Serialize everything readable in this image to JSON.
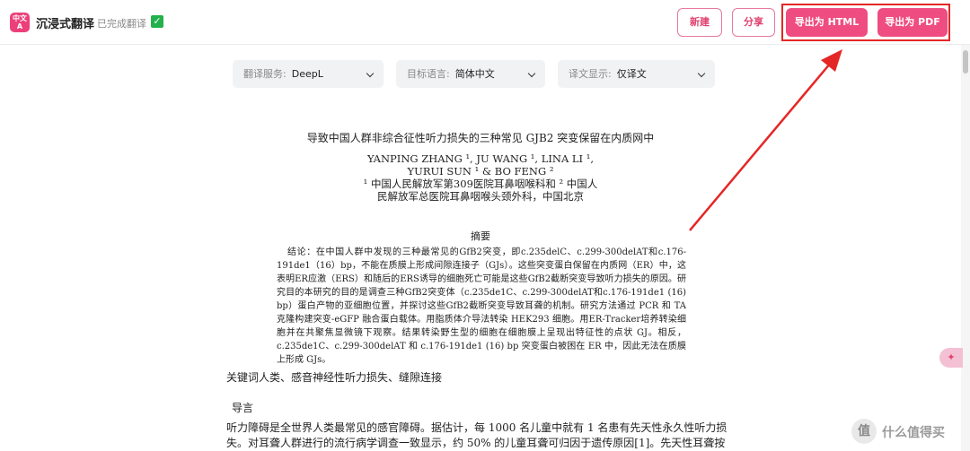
{
  "header": {
    "logo_text": "中文A",
    "app_name": "沉浸式翻译",
    "status_text": "已完成翻译",
    "status_icon": "check-icon",
    "buttons": {
      "new": "新建",
      "share": "分享",
      "export_html": "导出为 HTML",
      "export_pdf": "导出为 PDF"
    }
  },
  "controls": {
    "service": {
      "label": "翻译服务:",
      "value": "DeepL"
    },
    "target": {
      "label": "目标语言:",
      "value": "简体中文"
    },
    "display": {
      "label": "译文显示:",
      "value": "仅译文"
    }
  },
  "document": {
    "title": "导致中国人群非综合征性听力损失的三种常见 GJB2 突变保留在内质网中",
    "authors_line1": "YANPING ZHANG ¹, JU WANG ¹, LINA LI ¹,",
    "authors_line2": "YURUI SUN ¹ & BO FENG ²",
    "affil_line1": "¹ 中国人民解放军第309医院耳鼻咽喉科和 ² 中国人",
    "affil_line2": "民解放军总医院耳鼻咽喉头颈外科，中国北京",
    "abstract_heading": "摘要",
    "abstract": "结论：在中国人群中发现的三种最常见的GfB2突变，即c.235delC、c.299-300delAT和c.176-191de1（16）bp，不能在质膜上形成间隙连接子（GJs）。这些突变蛋白保留在内质网（ER）中，这表明ER应激（ERS）和随后的ERS诱导的细胞死亡可能是这些GfB2截断突变导致听力损失的原因。研究目的本研究的目的是调查三种GfB2突变体（c.235de1C、c.299-300delAT和c.176-191de1 (16) bp）蛋白产物的亚细胞位置，并探讨这些GfB2截断突变导致耳聋的机制。研究方法通过 PCR 和 TA 克隆构建突变-eGFP 融合蛋白载体。用脂质体介导法转染 HEK293 细胞。用ER-Tracker培养转染细胞并在共聚焦显微镜下观察。结果转染野生型的细胞在细胞膜上呈现出特征性的点状 GJ。相反，c.235de1C、c.299-300delAT 和 c.176-191de1 (16) bp 突变蛋白被困在 ER 中，因此无法在质膜上形成 GJs。",
    "keywords": "关键词人类、感音神经性听力损失、缝隙连接",
    "intro_heading": "导言",
    "intro": "听力障碍是全世界人类最常见的感官障碍。据估计，每 1000 名儿童中就有 1 名患有先天性永久性听力损失。对耳聋人群进行的流行病学调查一致显示，约 50% 的儿童耳聋可归因于遗传原因[1]。先天性耳聋按遗"
  },
  "side": {
    "float_icon": "translate-icon",
    "watermark_badge": "值",
    "watermark_text": "什么值得买"
  },
  "colors": {
    "accent": "#ef4d82",
    "highlight": "#e52626",
    "arrow": "#e52626"
  }
}
